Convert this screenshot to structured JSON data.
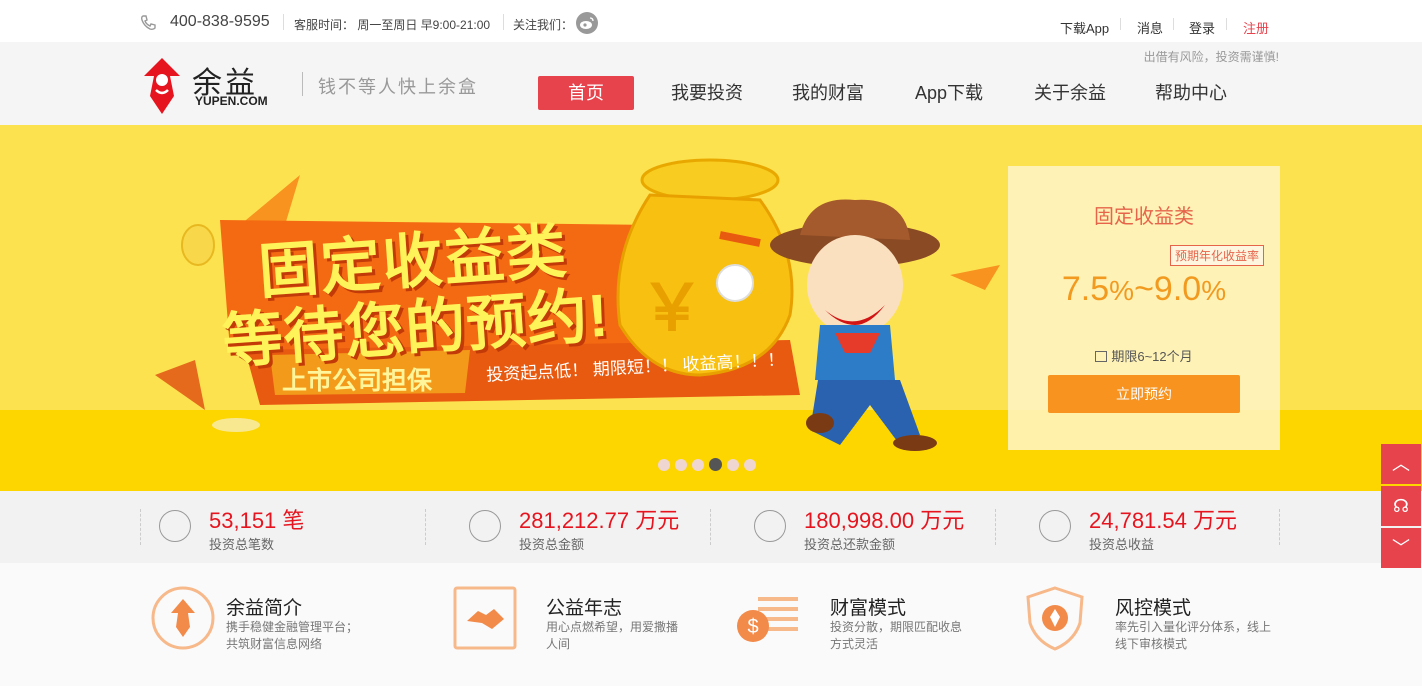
{
  "topbar": {
    "phone": "400-838-9595",
    "hours": "客服时间： 周一至周日  早9:00-21:00",
    "follow": "关注我们：",
    "links": [
      "下载App",
      "消息",
      "登录",
      "注册"
    ]
  },
  "header": {
    "risk_notice": "出借有风险，投资需谨慎!",
    "logo_cn": "余益",
    "logo_en": "YUPEN.COM",
    "slogan": "钱不等人快上余盒",
    "nav": [
      "首页",
      "我要投资",
      "我的财富",
      "App下载",
      "关于余益",
      "帮助中心"
    ],
    "active_nav": "首页"
  },
  "banner": {
    "headline_1": "固定收益类",
    "headline_2": "等待您的预约!",
    "guarantee": "上市公司担保",
    "tagline": "投资起点低！ 期限短！！ 收益高！！！",
    "coin_symbol": "￥"
  },
  "card": {
    "title": "固定收益类",
    "tag": "预期年化收益率",
    "rate_low": "7.5",
    "rate_high": "9.0",
    "pct": "%",
    "tilde": "~",
    "term": "期限6~12个月",
    "button": "立即预约"
  },
  "carousel": {
    "count": 6,
    "active_index": 3
  },
  "stats": [
    {
      "value": "53,151 笔",
      "label": "投资总笔数",
      "icon": "coins-icon"
    },
    {
      "value": "281,212.77 万元",
      "label": "投资总金额",
      "icon": "money-bag-icon"
    },
    {
      "value": "180,998.00 万元",
      "label": "投资总还款金额",
      "icon": "repayment-icon"
    },
    {
      "value": "24,781.54 万元",
      "label": "投资总收益",
      "icon": "growth-chart-icon"
    }
  ],
  "features": [
    {
      "title": "余益简介",
      "desc": "携手稳健金融管理平台；共筑财富信息网络",
      "icon": "logo-badge-icon"
    },
    {
      "title": "公益年志",
      "desc": "用心点燃希望，用爱撒播人间",
      "icon": "handshake-icon"
    },
    {
      "title": "财富模式",
      "desc": "投资分散，期限匹配收息方式灵活",
      "icon": "dollar-coin-icon"
    },
    {
      "title": "风控模式",
      "desc": "率先引入量化评分体系，线上线下审核模式",
      "icon": "shield-icon"
    }
  ],
  "sidebar": {
    "up": "︿",
    "service": "☊",
    "down": "﹀"
  },
  "colors": {
    "brand_red": "#e6434d",
    "orange": "#f7931e",
    "banner_yellow": "#fde250"
  }
}
